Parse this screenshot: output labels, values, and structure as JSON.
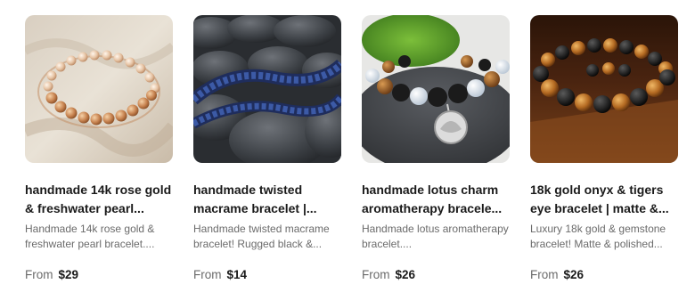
{
  "products": [
    {
      "title": "handmade 14k rose gold & freshwater pearl...",
      "description": "Handmade 14k rose gold & freshwater pearl bracelet....",
      "from_label": "From",
      "price": "$29",
      "image": "rose-gold-pearl-bracelet-photo"
    },
    {
      "title": "handmade twisted macrame bracelet |...",
      "description": "Handmade twisted macrame bracelet! Rugged black &...",
      "from_label": "From",
      "price": "$14",
      "image": "macrame-bracelet-on-stones-photo"
    },
    {
      "title": "handmade lotus charm aromatherapy bracele...",
      "description": "Handmade lotus aromatherapy bracelet....",
      "from_label": "From",
      "price": "$26",
      "image": "lotus-charm-bead-bracelet-photo"
    },
    {
      "title": "18k gold onyx & tigers eye bracelet | matte &...",
      "description": "Luxury 18k gold & gemstone bracelet! Matte & polished...",
      "from_label": "From",
      "price": "$26",
      "image": "onyx-tigers-eye-bracelet-photo"
    }
  ]
}
